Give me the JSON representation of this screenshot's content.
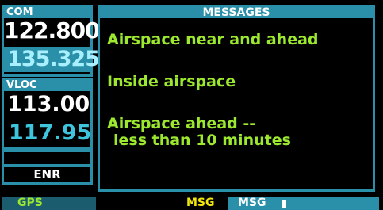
{
  "com": {
    "title": "COM",
    "active": "122.800",
    "standby": "135.325"
  },
  "vloc": {
    "title": "VLOC",
    "active": "113.00",
    "standby": "117.95"
  },
  "mode": {
    "label": "ENR"
  },
  "messages": {
    "title": "MESSAGES",
    "items": [
      {
        "line1": "Airspace near and ahead"
      },
      {
        "line1": "Inside airspace"
      },
      {
        "line1": "Airspace ahead --",
        "line2": "less than 10 minutes"
      }
    ]
  },
  "status_bar": {
    "gps": "GPS",
    "msg_annunciator": "MSG",
    "msg_page": "MSG"
  },
  "colors": {
    "frame": "#2a8fa8",
    "message_text": "#9be82f",
    "annunciator": "#f2e60a",
    "standby_com": "#a8f0ff",
    "standby_vloc": "#3fc4de"
  }
}
